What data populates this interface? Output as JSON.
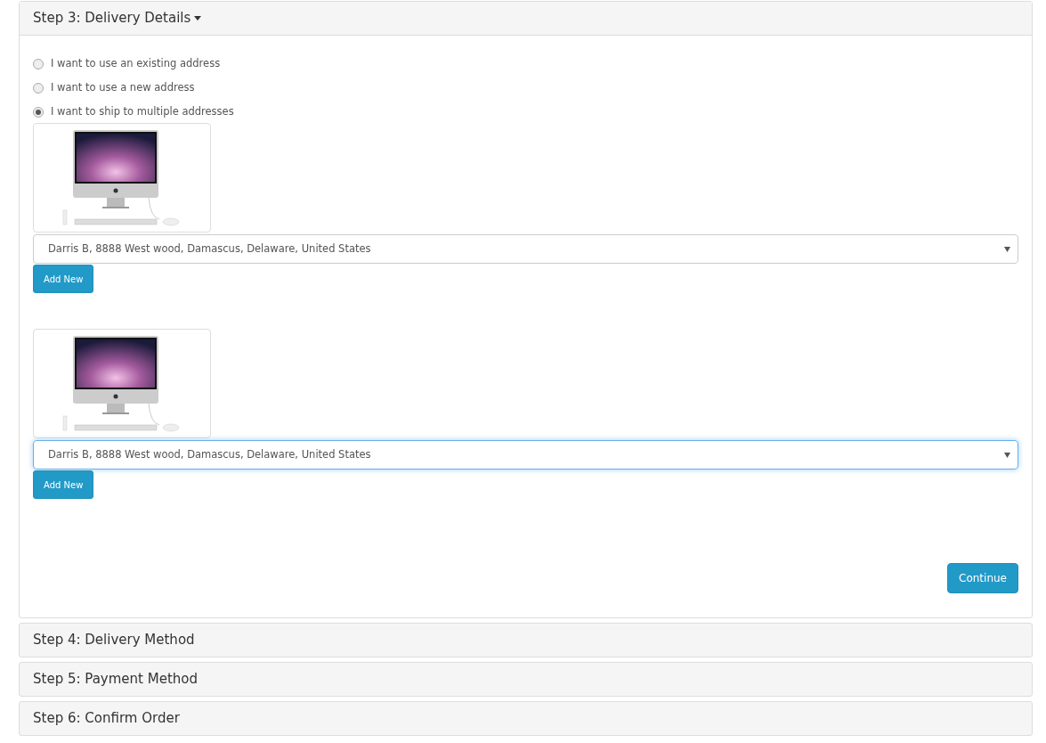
{
  "active_step": {
    "title": "Step 3: Delivery Details",
    "expanded": true,
    "address_options": [
      {
        "label": "I want to use an existing address",
        "selected": false
      },
      {
        "label": "I want to use a new address",
        "selected": false
      },
      {
        "label": "I want to ship to multiple addresses",
        "selected": true
      }
    ],
    "products": [
      {
        "address": "Darris B, 8888 West wood, Damascus, Delaware, United States",
        "focused": false,
        "button": "Add New"
      },
      {
        "address": "Darris B, 8888 West wood, Damascus, Delaware, United States",
        "focused": true,
        "button": "Add New"
      }
    ],
    "continue_button": "Continue"
  },
  "collapsed_steps": [
    {
      "title": "Step 4: Delivery Method"
    },
    {
      "title": "Step 5: Payment Method"
    },
    {
      "title": "Step 6: Confirm Order"
    }
  ]
}
